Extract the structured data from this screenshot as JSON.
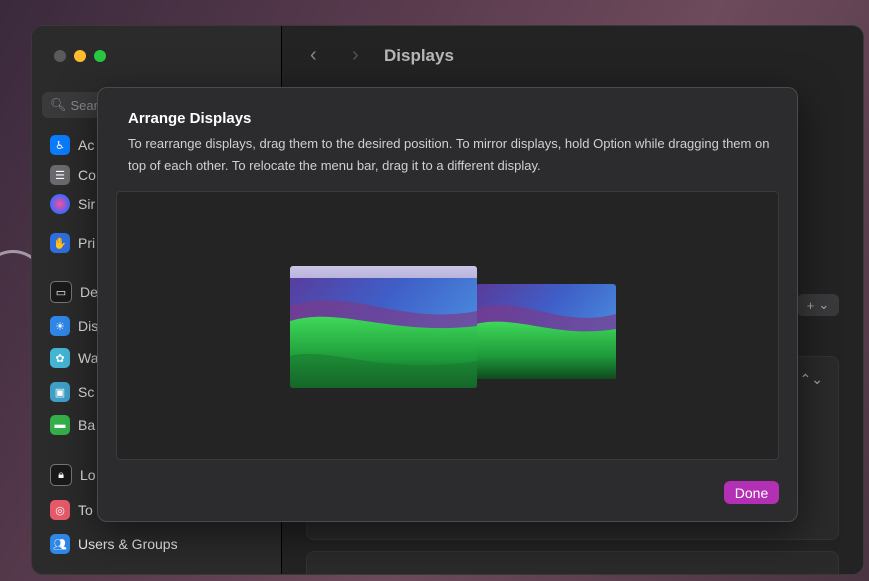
{
  "window": {
    "title": "Displays",
    "search_placeholder": "Search"
  },
  "sidebar": {
    "items": [
      {
        "label": "Ac",
        "icon": "accessibility-icon",
        "color": "#0a7cff"
      },
      {
        "label": "Co",
        "icon": "control-center-icon",
        "color": "#6b6b6f"
      },
      {
        "label": "Sir",
        "icon": "siri-icon",
        "color": "#7a3cc8"
      },
      {
        "label": "Pri",
        "icon": "privacy-hand-icon",
        "color": "#2f6fe0"
      },
      {
        "label": "De",
        "icon": "desktop-dock-icon",
        "color": "#1a1a1a"
      },
      {
        "label": "Dis",
        "icon": "displays-icon",
        "color": "#2f87e8"
      },
      {
        "label": "Wa",
        "icon": "wallpaper-icon",
        "color": "#44b6d6"
      },
      {
        "label": "Sc",
        "icon": "screen-saver-icon",
        "color": "#3fa0c8"
      },
      {
        "label": "Ba",
        "icon": "battery-icon",
        "color": "#34b04a"
      },
      {
        "label": "Lo",
        "icon": "lock-screen-icon",
        "color": "#1a1a1a"
      },
      {
        "label": "To",
        "icon": "touch-id-icon",
        "color": "#e85a6a"
      },
      {
        "label": "Users & Groups",
        "icon": "users-groups-icon",
        "color": "#2f87e8"
      }
    ]
  },
  "content": {
    "add_label": "+"
  },
  "modal": {
    "title": "Arrange Displays",
    "description": "To rearrange displays, drag them to the desired position. To mirror displays, hold Option while dragging them on top of each other. To relocate the menu bar, drag it to a different display.",
    "done_label": "Done",
    "accent_color": "#b32fb4"
  }
}
